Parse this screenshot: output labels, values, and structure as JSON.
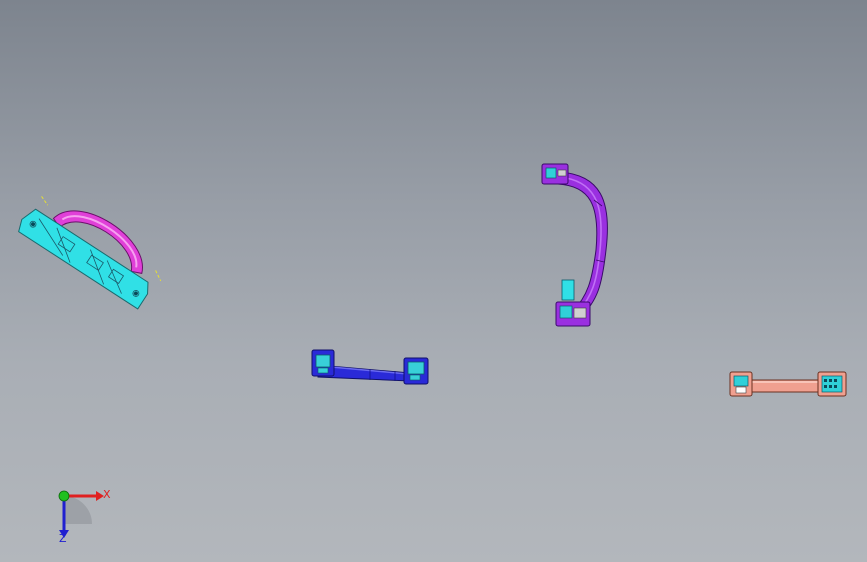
{
  "viewport": {
    "background_top": "#7d848e",
    "background_bottom": "#b3b7bc"
  },
  "parts": [
    {
      "name": "handle-cyan-magenta",
      "colors": [
        "#30e0e6",
        "#e040d8"
      ]
    },
    {
      "name": "handle-blue",
      "colors": [
        "#2a2ad8",
        "#38d0d8"
      ]
    },
    {
      "name": "handle-purple",
      "colors": [
        "#9a30e0",
        "#30d0d8"
      ]
    },
    {
      "name": "handle-salmon",
      "colors": [
        "#f0a090",
        "#30d0d8"
      ]
    }
  ],
  "triad": {
    "x_label": "X",
    "z_label": "Z",
    "x_color": "#e02020",
    "y_color": "#20c020",
    "z_color": "#2020d0"
  }
}
